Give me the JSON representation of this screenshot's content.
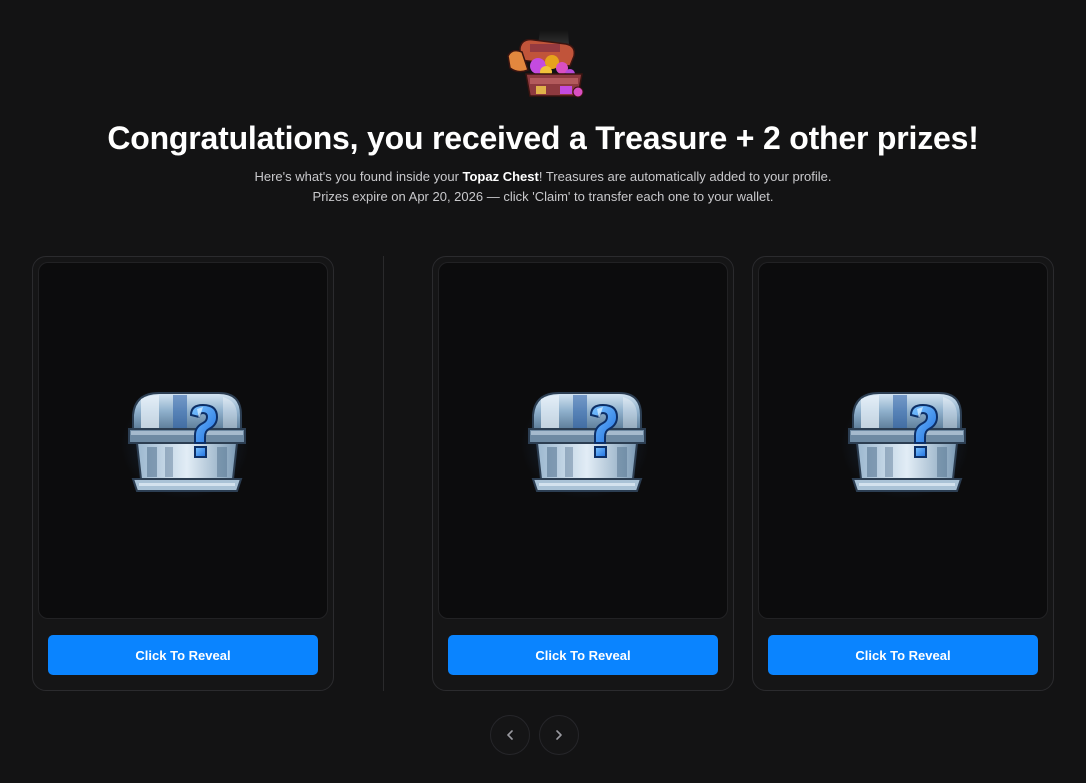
{
  "header": {
    "icon": "topaz-chest-icon",
    "title": "Congratulations, you received a Treasure + 2 other prizes!",
    "subtitle_line1_prefix": "Here's what's you found inside your ",
    "subtitle_chest_name": "Topaz Chest",
    "subtitle_line1_suffix": "! Treasures are automatically added to your profile.",
    "subtitle_line2": "Prizes expire on Apr 20, 2026 — click 'Claim' to transfer each one to your wallet."
  },
  "cards": [
    {
      "icon": "mystery-chest-icon",
      "button_label": "Click To Reveal"
    },
    {
      "icon": "mystery-chest-icon",
      "button_label": "Click To Reveal"
    },
    {
      "icon": "mystery-chest-icon",
      "button_label": "Click To Reveal"
    }
  ],
  "pagination": {
    "prev_icon": "chevron-left-icon",
    "next_icon": "chevron-right-icon"
  },
  "colors": {
    "background": "#131314",
    "accent": "#0a84ff",
    "card_border": "#2b2b2e"
  }
}
